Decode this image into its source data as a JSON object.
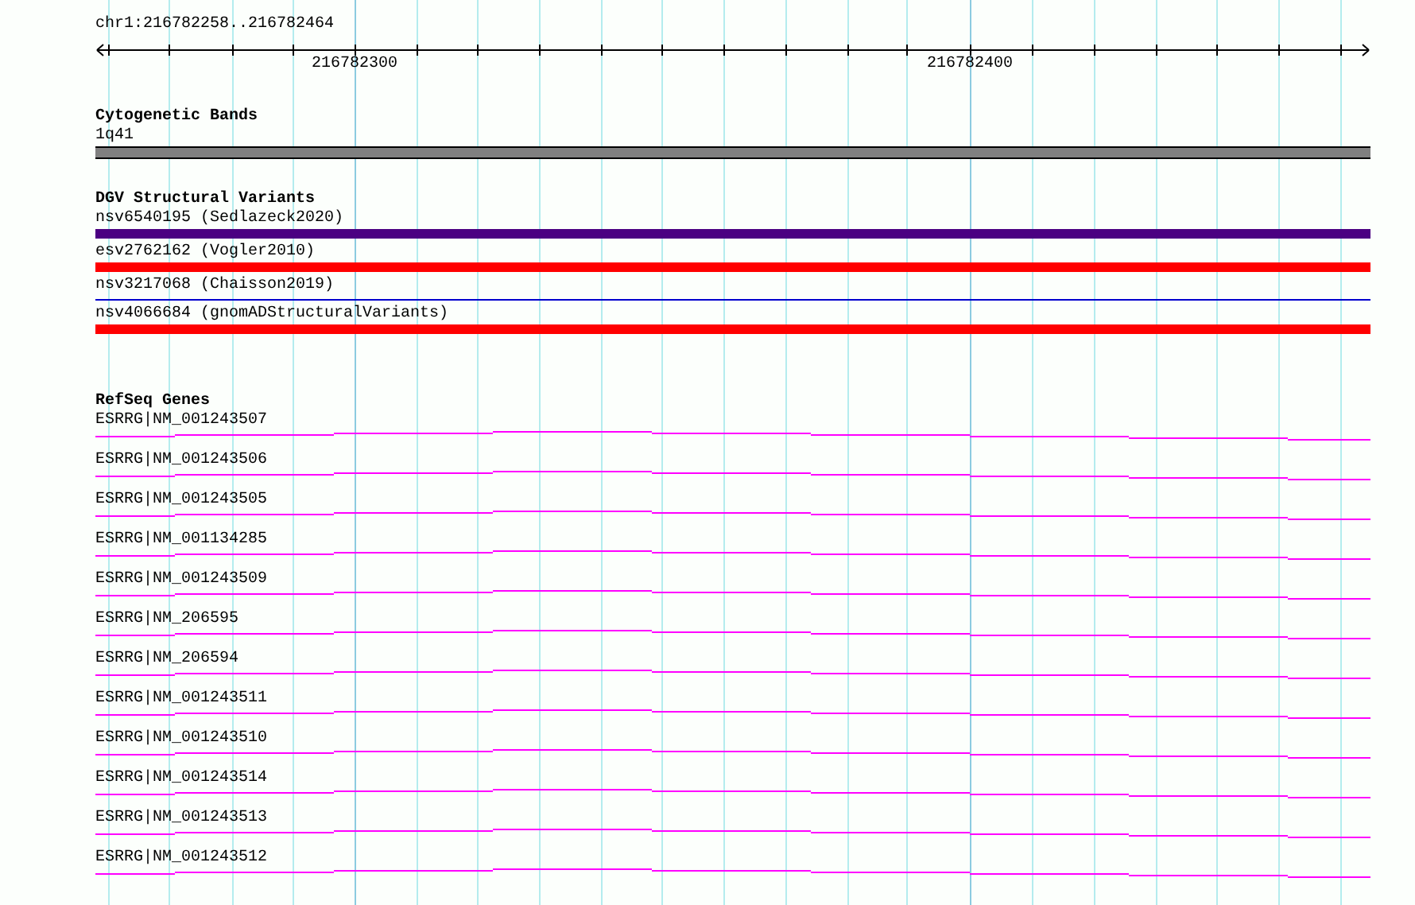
{
  "ruler": {
    "location": "chr1:216782258..216782464",
    "ticks": [
      {
        "label": "216782300"
      },
      {
        "label": "216782400"
      }
    ]
  },
  "tracks": [
    {
      "kind": "bands",
      "title": "Cytogenetic Bands",
      "features": [
        {
          "label": "1q41",
          "color": "#808080"
        }
      ]
    },
    {
      "kind": "variants",
      "title": "DGV Structural Variants",
      "features": [
        {
          "label": "nsv6540195 (Sedlazeck2020)",
          "color": "#4b0082",
          "kind": "bar"
        },
        {
          "label": "esv2762162 (Vogler2010)",
          "color": "#ff0000",
          "kind": "bar"
        },
        {
          "label": "nsv3217068 (Chaisson2019)",
          "color": "#0000cd",
          "kind": "line"
        },
        {
          "label": "nsv4066684 (gnomADStructuralVariants)",
          "color": "#ff0000",
          "kind": "bar"
        }
      ]
    },
    {
      "kind": "genes",
      "title": "RefSeq Genes",
      "features": [
        {
          "label": "ESRRG|NM_001243507"
        },
        {
          "label": "ESRRG|NM_001243506"
        },
        {
          "label": "ESRRG|NM_001243505"
        },
        {
          "label": "ESRRG|NM_001134285"
        },
        {
          "label": "ESRRG|NM_001243509"
        },
        {
          "label": "ESRRG|NM_206595"
        },
        {
          "label": "ESRRG|NM_206594"
        },
        {
          "label": "ESRRG|NM_001243511"
        },
        {
          "label": "ESRRG|NM_001243510"
        },
        {
          "label": "ESRRG|NM_001243514"
        },
        {
          "label": "ESRRG|NM_001243513"
        },
        {
          "label": "ESRRG|NM_001243512"
        }
      ]
    }
  ]
}
